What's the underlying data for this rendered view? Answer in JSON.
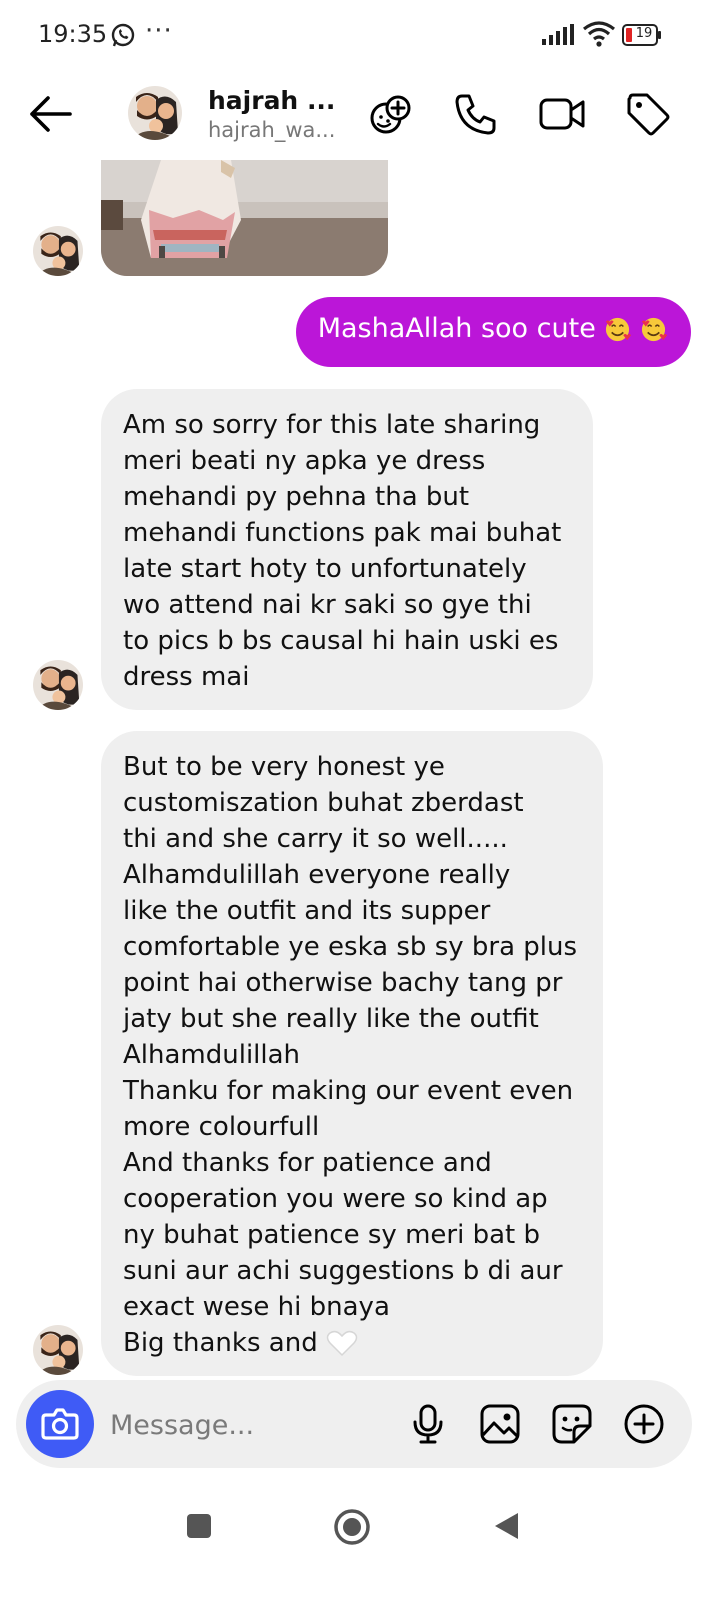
{
  "status_bar": {
    "time": "19:35",
    "more_indicator": "···",
    "battery_level": "19",
    "icons": [
      "whatsapp-icon",
      "signal-icon",
      "wifi-icon",
      "battery-icon"
    ]
  },
  "header": {
    "name": "hajrah ...",
    "username": "hajrah_wa...",
    "icons": [
      "back-arrow-icon",
      "effects-icon",
      "phone-icon",
      "video-icon",
      "tag-icon"
    ]
  },
  "messages": [
    {
      "type": "incoming",
      "lines": [
        "Am so sorry for this late sharing",
        "meri beati ny apka ye dress",
        "mehandi py pehna tha but",
        "mehandi functions pak mai buhat",
        "late start hoty to unfortunately",
        "wo attend nai kr saki so gye thi",
        "to pics b bs causal hi hain uski es",
        "dress mai"
      ]
    },
    {
      "type": "incoming",
      "lines": [
        "But to be very honest ye",
        "customiszation buhat zberdast",
        "thi and she carry it so well.....",
        "Alhamdulillah everyone really",
        "like the outfit and its supper",
        "comfortable ye eska sb sy bra plus",
        "point hai otherwise bachy tang pr",
        "jaty but she really like the outfit",
        "Alhamdulillah",
        "Thanku for making our event even",
        "more colourfull",
        "And thanks for patience and",
        "cooperation you were so kind ap",
        "ny buhat patience sy meri bat b",
        "suni aur achi suggestions b di aur",
        "exact wese hi bnaya",
        "Big thanks and"
      ]
    }
  ],
  "outgoing": {
    "text": "MashaAllah soo cute",
    "emoji": "smiling-face-with-hearts-icon"
  },
  "composer": {
    "placeholder": "Message...",
    "icons": [
      "camera-icon",
      "microphone-icon",
      "gallery-icon",
      "sticker-icon",
      "add-icon"
    ]
  },
  "colors": {
    "outgoing_bubble": "#bb16d8",
    "incoming_bubble": "#efefef",
    "camera_button": "#3f5bf6"
  }
}
